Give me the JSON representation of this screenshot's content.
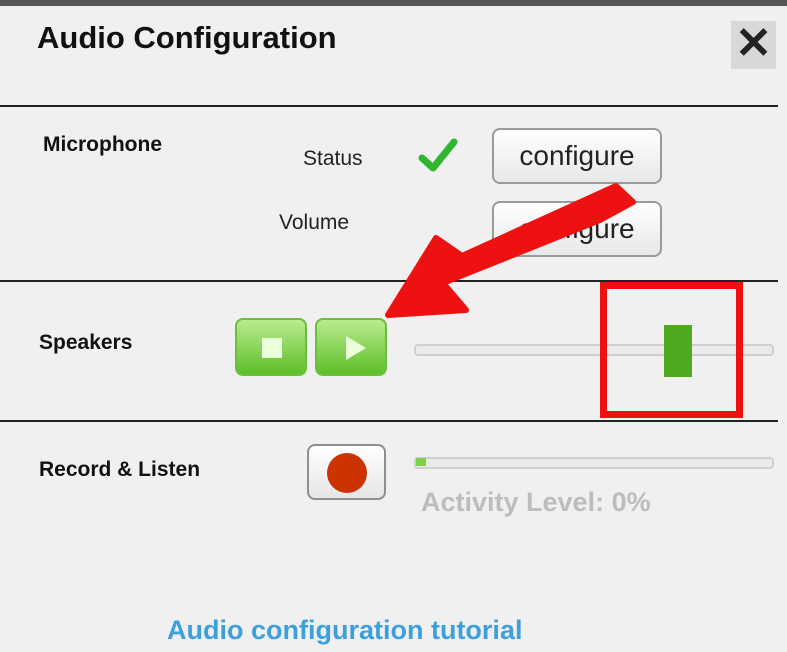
{
  "dialog": {
    "title": "Audio Configuration",
    "close_label": "✕"
  },
  "microphone": {
    "section_label": "Microphone",
    "status_label": "Status",
    "status_ok": true,
    "status_icon": "checkmark-icon",
    "volume_label": "Volume",
    "configure_label": "configure",
    "volume_configure_label": "configure"
  },
  "speakers": {
    "section_label": "Speakers",
    "stop_icon": "stop-icon",
    "play_icon": "play-icon",
    "volume_level": 0.77
  },
  "record": {
    "section_label": "Record & Listen",
    "record_icon": "record-icon",
    "activity_text": "Activity Level: 0%",
    "activity_level": 0
  },
  "footer": {
    "tutorial_link": "Audio configuration tutorial"
  },
  "annotations": {
    "arrow_color": "#ee1111",
    "highlight_color": "#ee1111"
  },
  "colors": {
    "accent_green": "#5fbe2a",
    "link_blue": "#3da0dc",
    "record_red": "#cc3300"
  }
}
